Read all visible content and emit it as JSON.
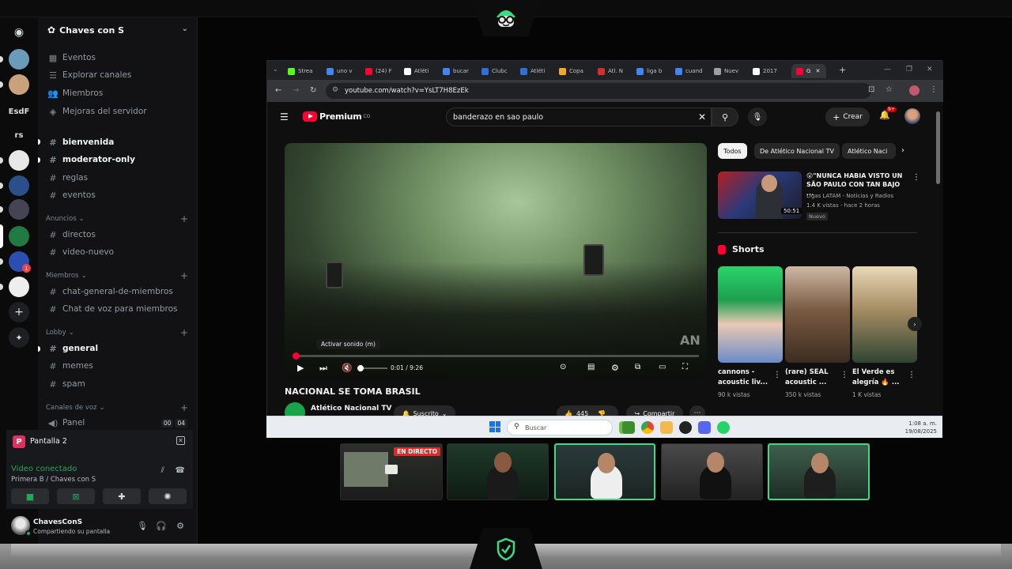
{
  "discord": {
    "server_rail": {
      "servers": [
        {
          "label": "",
          "icon": "discord-home-icon"
        },
        {
          "label": "",
          "icon": "server-avatar-1"
        },
        {
          "label": "",
          "icon": "server-avatar-2"
        },
        {
          "label": "EsdF",
          "icon": "server-text-icon"
        },
        {
          "label": "rs",
          "icon": "server-text-icon"
        },
        {
          "label": "",
          "icon": "soccer-ball-icon"
        },
        {
          "label": "",
          "icon": "crest-icon"
        },
        {
          "label": "",
          "icon": "shield-crest-icon"
        },
        {
          "label": "",
          "icon": "chaves-server-icon"
        },
        {
          "label": "",
          "icon": "s-server-icon"
        },
        {
          "label": "",
          "icon": "dark-crest-icon"
        },
        {
          "label": "",
          "icon": "add-server-icon"
        },
        {
          "label": "",
          "icon": "explore-icon"
        }
      ],
      "mention_badge": "1"
    },
    "server_name": "Chaves con S",
    "top_links": [
      "Eventos",
      "Explorar canales",
      "Miembros",
      "Mejoras del servidor"
    ],
    "channels_top": [
      "bienvenida",
      "moderator-only",
      "reglas",
      "eventos"
    ],
    "categories": [
      {
        "name": "Anuncios",
        "channels": [
          "directos",
          "video-nuevo"
        ]
      },
      {
        "name": "Miembros",
        "channels": [
          "chat-general-de-miembros",
          "Chat de voz para miembros"
        ]
      },
      {
        "name": "Lobby",
        "channels": [
          "general",
          "memes",
          "spam"
        ]
      },
      {
        "name": "Canales de voz",
        "channels": [
          "Panel"
        ]
      }
    ],
    "voice_badge": [
      "00",
      "04"
    ],
    "screen_share": {
      "badge": "P",
      "name": "Pantalla 2"
    },
    "voice_status": "Video conectado",
    "voice_location": "Primera B / Chaves con S",
    "user": {
      "name": "ChavesConS",
      "status": "Compartiendo su pantalla"
    }
  },
  "browser": {
    "tabs": [
      {
        "label": "Strea",
        "color": "#53fc18"
      },
      {
        "label": "uno v",
        "color": "#4285f4"
      },
      {
        "label": "(24) F",
        "color": "#ff0033"
      },
      {
        "label": "Atléti",
        "color": "#ffffff"
      },
      {
        "label": "bucar",
        "color": "#4285f4"
      },
      {
        "label": "Clubc",
        "color": "#2f6fd6"
      },
      {
        "label": "Atléti",
        "color": "#2f6fd6"
      },
      {
        "label": "Copa",
        "color": "#f5a623"
      },
      {
        "label": "Atl. N",
        "color": "#d32f2f"
      },
      {
        "label": "liga b",
        "color": "#4285f4"
      },
      {
        "label": "cuand",
        "color": "#4285f4"
      },
      {
        "label": "Nuev",
        "color": "#9aa0a6"
      },
      {
        "label": "2017",
        "color": "#ffffff"
      },
      {
        "label": "G",
        "color": "#ff0033"
      }
    ],
    "url": "youtube.com/watch?v=YsLT7H8EzEk"
  },
  "youtube": {
    "logo_text": "Premium",
    "logo_sup": "CO",
    "search_query": "banderazo en sao paulo",
    "create_label": "Crear",
    "notif_count": "9+",
    "player": {
      "tooltip": "Activar sonido (m)",
      "current_time": "0:01",
      "duration": "9:26",
      "time_display": "0:01 / 9:26",
      "progress_fraction": 0.002,
      "volume_fraction": 0.0,
      "watermark": "AN"
    },
    "video_title": "NACIONAL SE TOMA BRASIL",
    "channel_name": "Atlético Nacional TV",
    "subscribe_label": "Suscrito",
    "likes": "445",
    "share_label": "Compartir",
    "chips": [
      "Todos",
      "De Atlético Nacional TV",
      "Atlético Naci"
    ],
    "recommendation": {
      "title": "😮\"NUNCA HABIA VISTO UN SÃO PAULO CON TAN BAJO ...",
      "channel": "Ligas LATAM - Noticias y Radios",
      "meta": "1.4 K vistas - hace 2 horas",
      "badge": "Nuevo",
      "duration": "50:51"
    },
    "shorts_title": "Shorts",
    "shorts": [
      {
        "title": "cannons - acoustic liv...",
        "views": "90 k vistas"
      },
      {
        "title": "(rare) SEAL acoustic ...",
        "views": "350 k vistas"
      },
      {
        "title": "El Verde es alegría 🔥 ...",
        "views": "1 K vistas"
      }
    ]
  },
  "taskbar": {
    "search_label": "Buscar",
    "time": "1:08 a. m.",
    "date": "19/08/2025"
  },
  "stream": {
    "live_label": "EN DIRECTO",
    "accent": "#3ddc84"
  }
}
